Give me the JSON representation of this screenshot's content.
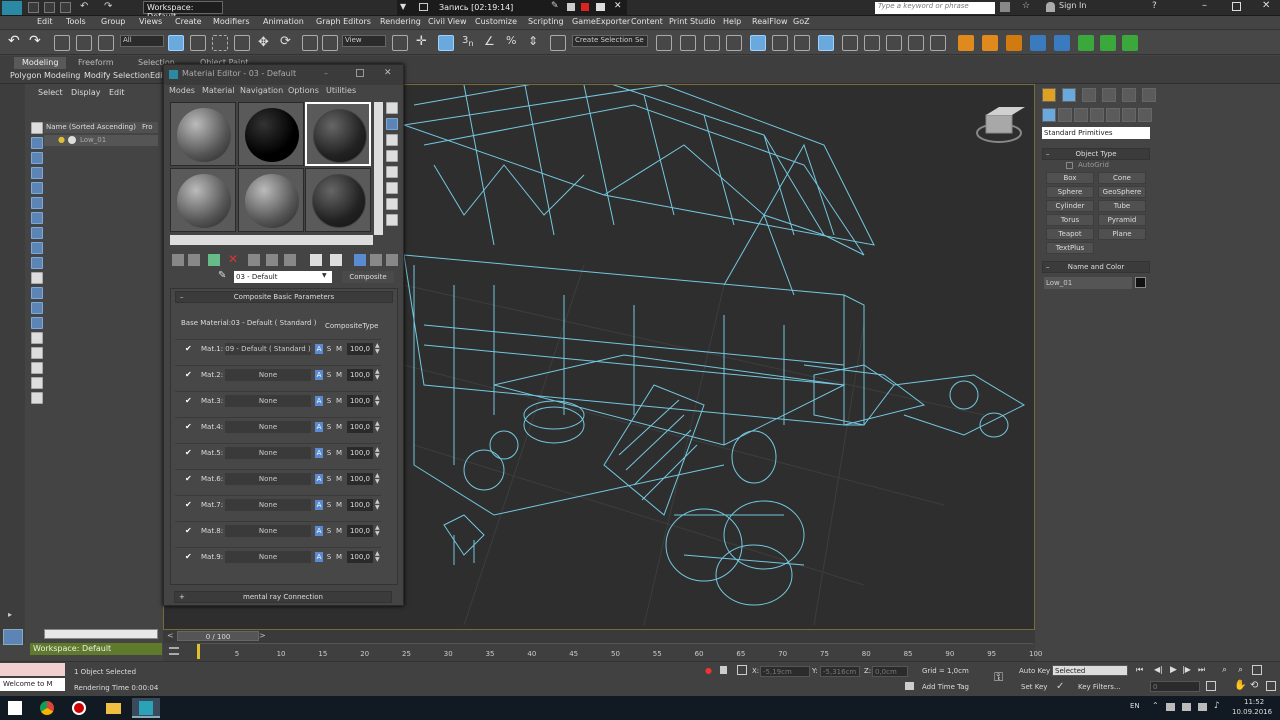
{
  "titlebar": {
    "workspace": "Workspace: Default",
    "record_text": "Запись [02:19:14]",
    "search_placeholder": "Type a keyword or phrase",
    "signin": "Sign In"
  },
  "menubar": {
    "items": [
      "Edit",
      "Tools",
      "Group",
      "Views",
      "Create",
      "Modifiers",
      "Animation",
      "Graph Editors",
      "Rendering",
      "Civil View",
      "Customize",
      "Scripting",
      "GameExporter",
      "Content",
      "Print Studio",
      "Help",
      "RealFlow",
      "GoZ"
    ]
  },
  "toolbar": {
    "filter_dropdown": "All",
    "view_dropdown": "View",
    "selection_set": "Create Selection Se"
  },
  "ribbon": {
    "tabs": [
      "Modeling",
      "Freeform",
      "Selection",
      "Object Paint"
    ],
    "subtabs": [
      "Polygon Modeling",
      "Modify Selection",
      "Edit"
    ]
  },
  "explorer": {
    "menu": [
      "Select",
      "Display",
      "Edit"
    ],
    "column_header": "Name (Sorted Ascending)",
    "column_header2": "Fro",
    "row": "Low_01",
    "workspace": "Workspace: Default"
  },
  "material_editor": {
    "title": "Material Editor - 03 - Default",
    "menu": [
      "Modes",
      "Material",
      "Navigation",
      "Options",
      "Utilities"
    ],
    "material_name": "03 - Default",
    "material_type": "Composite",
    "rollout_title": "Composite Basic Parameters",
    "base_material_label": "Base Material:",
    "base_material_value": "03 - Default  ( Standard )",
    "composite_type": "CompositeType",
    "rows": [
      {
        "label": "Mat.1:",
        "button": "09 - Default  ( Standard )",
        "value": "100,0"
      },
      {
        "label": "Mat.2:",
        "button": "None",
        "value": "100,0"
      },
      {
        "label": "Mat.3:",
        "button": "None",
        "value": "100,0"
      },
      {
        "label": "Mat.4:",
        "button": "None",
        "value": "100,0"
      },
      {
        "label": "Mat.5:",
        "button": "None",
        "value": "100,0"
      },
      {
        "label": "Mat.6:",
        "button": "None",
        "value": "100,0"
      },
      {
        "label": "Mat.7:",
        "button": "None",
        "value": "100,0"
      },
      {
        "label": "Mat.8:",
        "button": "None",
        "value": "100,0"
      },
      {
        "label": "Mat.9:",
        "button": "None",
        "value": "100,0"
      }
    ],
    "flag_a": "A",
    "flag_s": "S",
    "flag_m": "M",
    "mentalray": "mental ray Connection",
    "plus": "+"
  },
  "command_panel": {
    "category": "Standard Primitives",
    "object_type": "Object Type",
    "autogrid": "AutoGrid",
    "buttons": [
      "Box",
      "Cone",
      "Sphere",
      "GeoSphere",
      "Cylinder",
      "Tube",
      "Torus",
      "Pyramid",
      "Teapot",
      "Plane",
      "TextPlus"
    ],
    "name_color": "Name and Color",
    "name_value": "Low_01"
  },
  "timeline": {
    "frame": "0 / 100",
    "ticks": [
      "5",
      "10",
      "15",
      "20",
      "25",
      "30",
      "35",
      "40",
      "45",
      "50",
      "55",
      "60",
      "65",
      "70",
      "75",
      "80",
      "85",
      "90",
      "95",
      "100"
    ]
  },
  "status": {
    "welcome": "Welcome to M",
    "selected": "1 Object Selected",
    "render_time": "Rendering Time  0:00:04",
    "x_label": "X:",
    "x_val": "-5,19cm",
    "y_label": "Y:",
    "y_val": "-5,316cm",
    "z_label": "Z:",
    "z_val": "0,0cm",
    "grid": "Grid = 1,0cm",
    "add_time_tag": "Add Time Tag",
    "auto_key": "Auto Key",
    "set_key": "Set Key",
    "key_dropdown": "Selected",
    "key_filters": "Key Filters...",
    "frame_val": "0"
  },
  "taskbar": {
    "lang": "EN",
    "time": "11:52",
    "date": "10.09.2016"
  }
}
